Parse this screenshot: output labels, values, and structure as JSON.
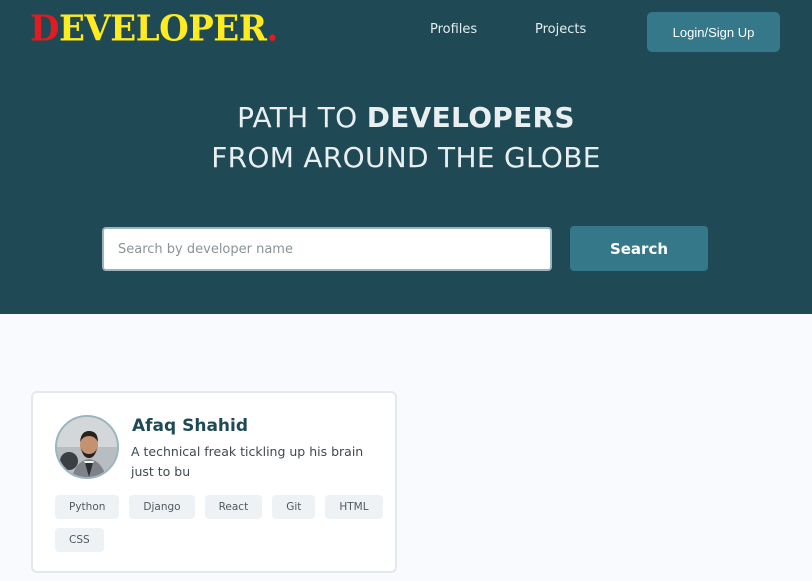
{
  "nav": {
    "logo_first": "D",
    "logo_rest": "EVELOPER",
    "logo_dot": ".",
    "links": [
      "Profiles",
      "Projects"
    ],
    "login_label": "Login/Sign Up"
  },
  "hero": {
    "line1_prefix": "PATH TO ",
    "line1_bold": "DEVELOPERS",
    "line2": "FROM AROUND THE GLOBE"
  },
  "search": {
    "placeholder": "Search by developer name",
    "button_label": "Search"
  },
  "profiles": [
    {
      "name": "Afaq Shahid",
      "bio": "A technical freak tickling up his brain just to bu",
      "skills": [
        "Python",
        "Django",
        "React",
        "Git",
        "HTML",
        "CSS"
      ]
    }
  ],
  "colors": {
    "hero_bg": "#1f4a55",
    "accent": "#35788a",
    "logo_red": "#e11b22",
    "logo_yellow": "#ffeb1f"
  }
}
